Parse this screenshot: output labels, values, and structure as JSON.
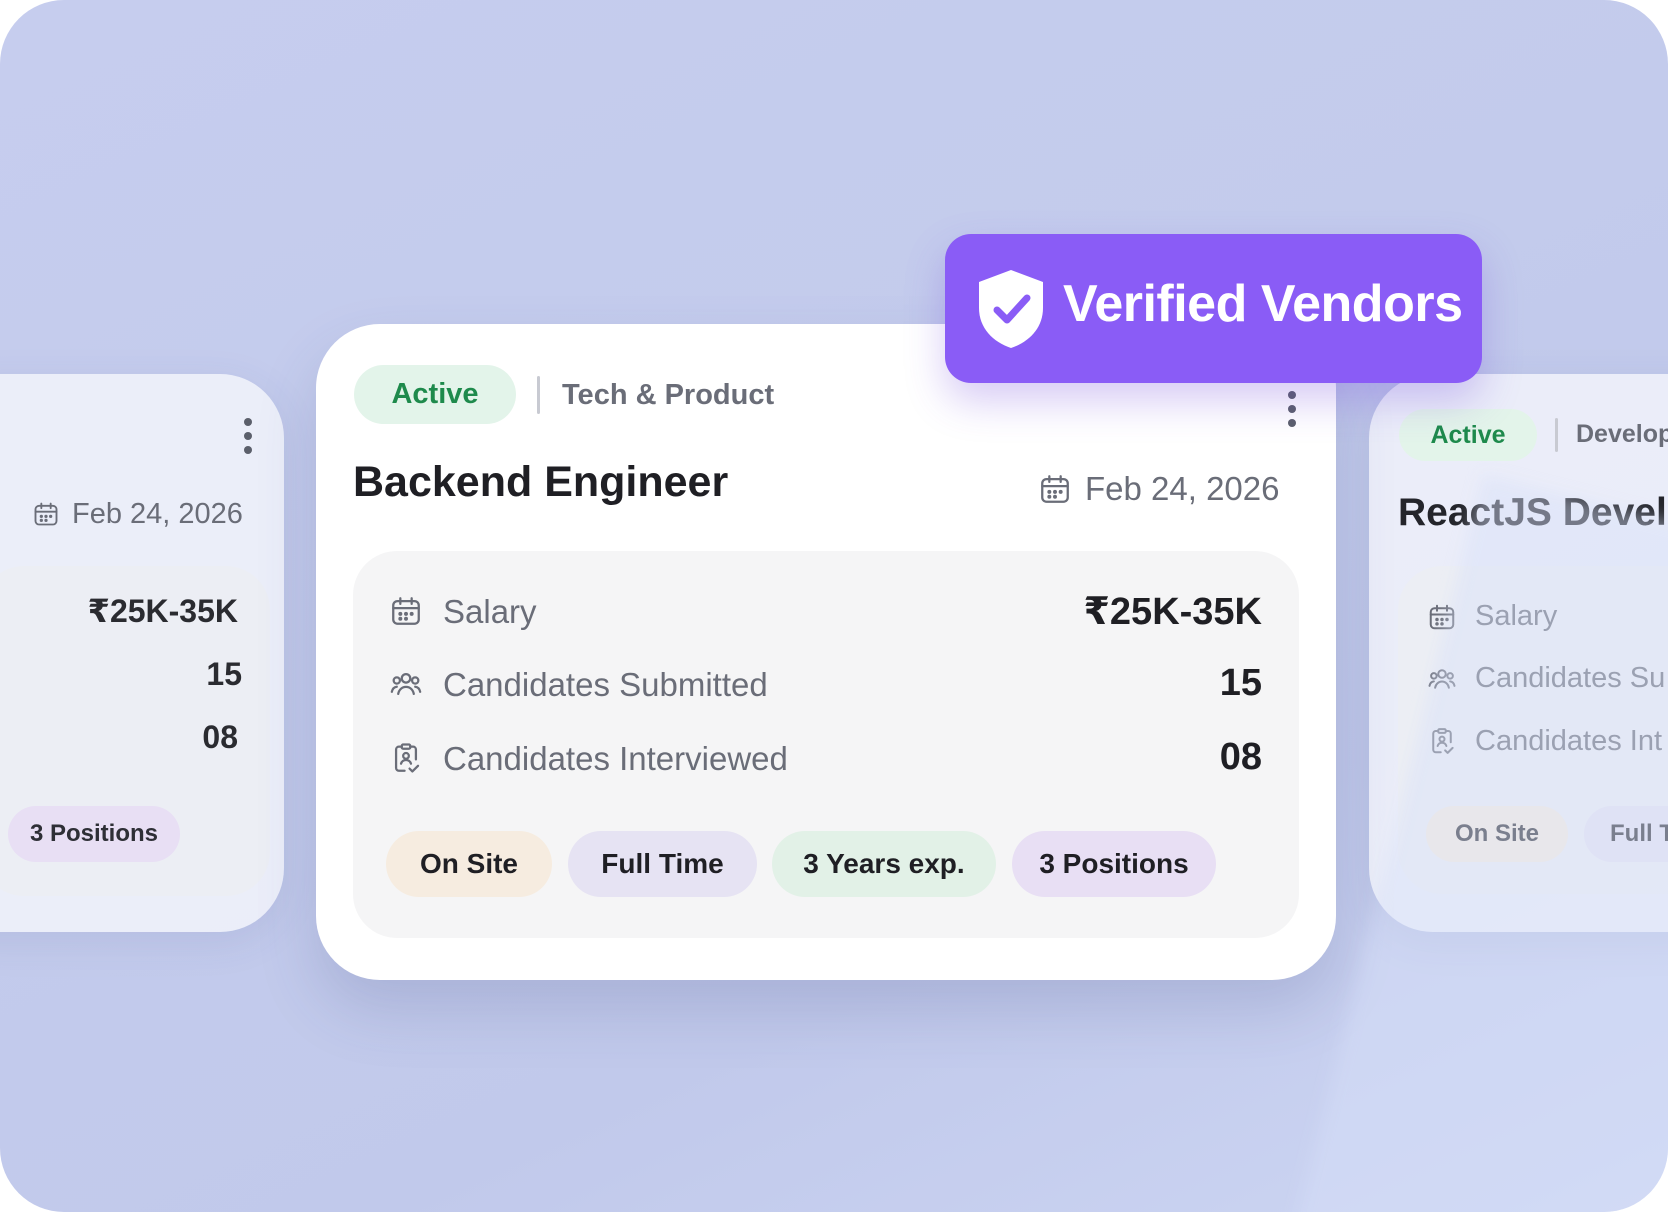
{
  "badge": {
    "label": "Verified Vendors",
    "icon": "shield-check-icon",
    "color": "#8a5cf6"
  },
  "left_card": {
    "date": "Feb 24, 2026",
    "values": [
      "₹25K-35K",
      "15",
      "08"
    ],
    "tags": [
      "3 Positions"
    ]
  },
  "main_card": {
    "status": "Active",
    "category": "Tech & Product",
    "title": "Backend Engineer",
    "date": "Feb 24, 2026",
    "stats": [
      {
        "icon": "calendar-icon",
        "label": "Salary",
        "value": "₹25K-35K"
      },
      {
        "icon": "users-icon",
        "label": "Candidates Submitted",
        "value": "15"
      },
      {
        "icon": "clipboard-user-icon",
        "label": "Candidates Interviewed",
        "value": "08"
      }
    ],
    "tags": [
      "On Site",
      "Full Time",
      "3 Years exp.",
      "3 Positions"
    ]
  },
  "right_card": {
    "status": "Active",
    "category": "Develop",
    "title": "ReactJS Devel",
    "stats": [
      {
        "icon": "calendar-icon",
        "label": "Salary"
      },
      {
        "icon": "users-icon",
        "label": "Candidates Su"
      },
      {
        "icon": "clipboard-user-icon",
        "label": "Candidates Int"
      }
    ],
    "tags": [
      "On Site",
      "Full T"
    ]
  },
  "colors": {
    "background": "#c4ccec",
    "status_bg": "#e3f4ea",
    "status_text": "#1e8a4c",
    "tag_onsite": "#f6ece0",
    "tag_fulltime": "#e6e3f3",
    "tag_exp": "#e2f1e7",
    "tag_positions": "#e8dff4"
  }
}
